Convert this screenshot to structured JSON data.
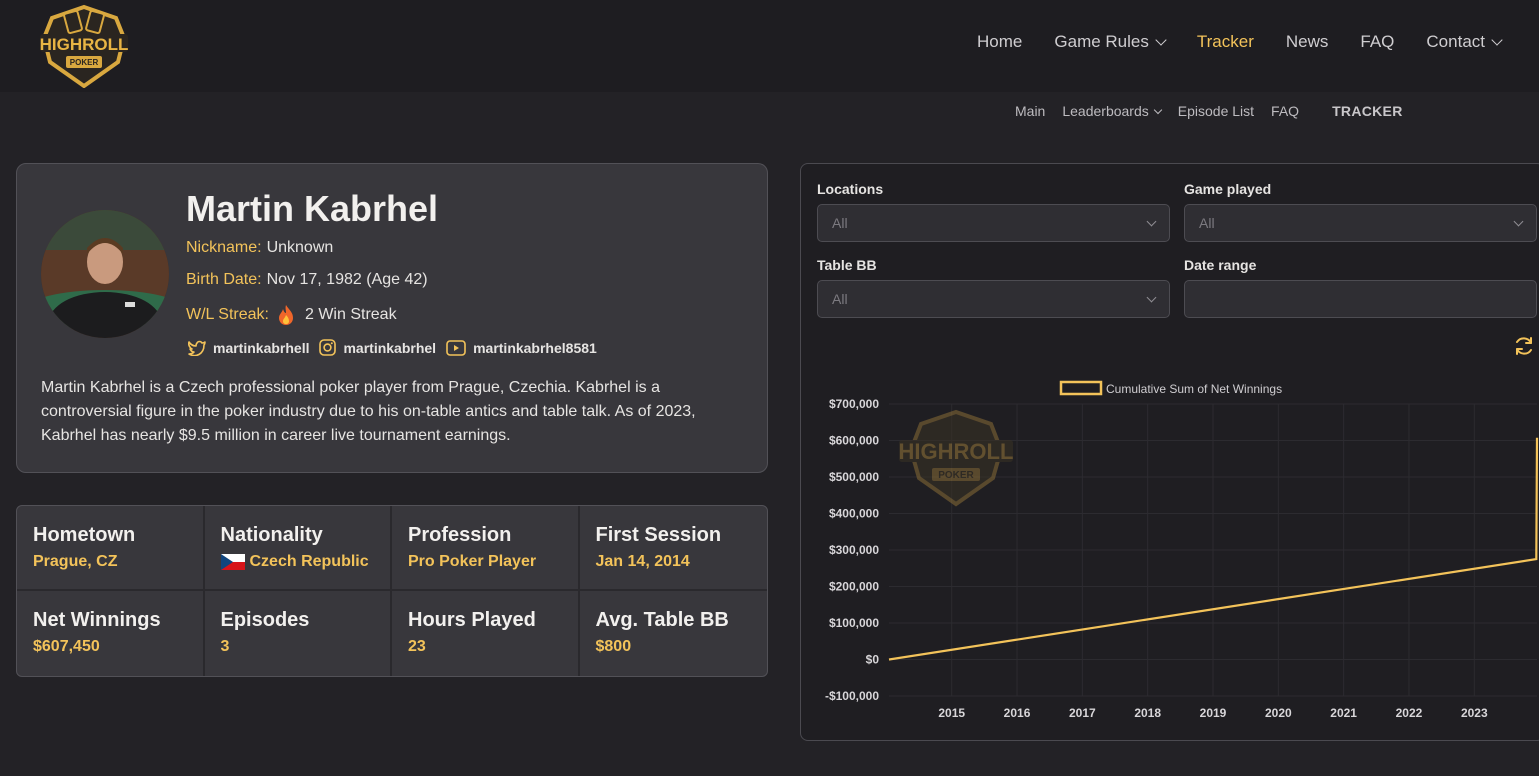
{
  "brand": {
    "logo_top": "HIGHROLL",
    "logo_bottom": "POKER",
    "accent": "#f3c35a"
  },
  "main_nav": [
    {
      "label": "Home",
      "dropdown": false
    },
    {
      "label": "Game Rules",
      "dropdown": true
    },
    {
      "label": "Tracker",
      "dropdown": false,
      "active": true
    },
    {
      "label": "News",
      "dropdown": false
    },
    {
      "label": "FAQ",
      "dropdown": false
    },
    {
      "label": "Contact",
      "dropdown": true
    }
  ],
  "sub_nav": {
    "main": "Main",
    "leaderboards": "Leaderboards",
    "episode_list": "Episode List",
    "faq": "FAQ",
    "tracker": "TRACKER"
  },
  "player": {
    "name": "Martin Kabrhel",
    "nickname_label": "Nickname:",
    "nickname": "Unknown",
    "birth_label": "Birth Date:",
    "birth": "Nov 17, 1982 (Age 42)",
    "streak_label": "W/L Streak:",
    "streak_icon": "fire-icon",
    "streak": "2 Win Streak",
    "twitter": "martinkabrhell",
    "instagram": "martinkabrhel",
    "youtube": "martinkabrhel8581",
    "bio": "Martin Kabrhel is a Czech professional poker player from Prague, Czechia. Kabrhel is a controversial figure in the poker industry due to his on-table antics and table talk. As of 2023, Kabrhel has nearly $9.5 million in career live tournament earnings."
  },
  "stats": [
    {
      "title": "Hometown",
      "value": "Prague, CZ"
    },
    {
      "title": "Nationality",
      "value": "Czech Republic",
      "flag": "czech-flag-icon"
    },
    {
      "title": "Profession",
      "value": "Pro Poker Player"
    },
    {
      "title": "First Session",
      "value": "Jan 14, 2014"
    },
    {
      "title": "Net Winnings",
      "value": "$607,450"
    },
    {
      "title": "Episodes",
      "value": "3"
    },
    {
      "title": "Hours Played",
      "value": "23"
    },
    {
      "title": "Avg. Table BB",
      "value": "$800"
    }
  ],
  "filters": {
    "locations": {
      "label": "Locations",
      "value": "All"
    },
    "game": {
      "label": "Game played",
      "value": "All"
    },
    "table_bb": {
      "label": "Table BB",
      "value": "All"
    },
    "date_range": {
      "label": "Date range",
      "value": ""
    }
  },
  "chart_data": {
    "type": "line",
    "title": "",
    "legend": "top-center",
    "series": [
      {
        "name": "Cumulative Sum of Net Winnings",
        "color": "#f3c35a",
        "x": [
          2014.04,
          2023.95,
          2023.96
        ],
        "y": [
          0,
          275000,
          607450
        ]
      }
    ],
    "xticks": [
      "2015",
      "2016",
      "2017",
      "2018",
      "2019",
      "2020",
      "2021",
      "2022",
      "2023"
    ],
    "xlim": [
      2014.04,
      2023.96
    ],
    "yticks": [
      "$700,000",
      "$600,000",
      "$500,000",
      "$400,000",
      "$300,000",
      "$200,000",
      "$100,000",
      "$0",
      "-$100,000"
    ],
    "ylim": [
      -100000,
      700000
    ],
    "grid": true
  }
}
